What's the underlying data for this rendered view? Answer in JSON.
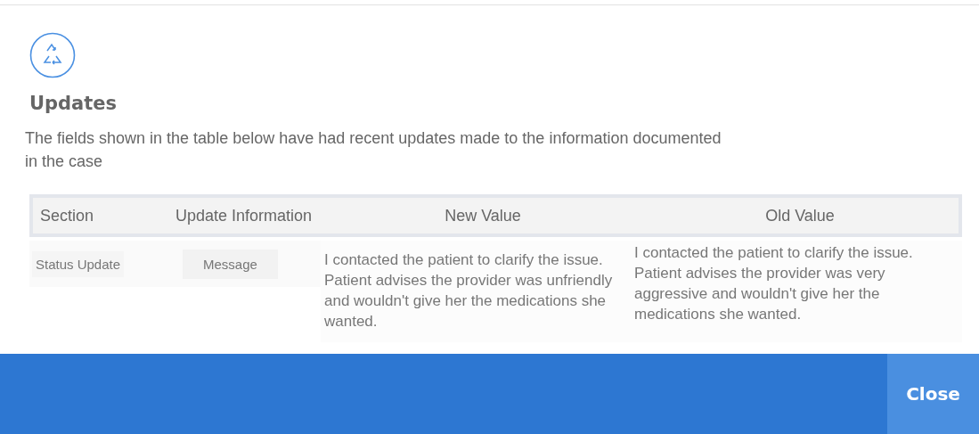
{
  "dialog": {
    "title": "Updates",
    "description": "The fields shown in the table below have had recent updates made to the information documented in the case"
  },
  "table": {
    "columns": [
      "Section",
      "Update Information",
      "New Value",
      "Old Value"
    ],
    "rows": [
      {
        "section": "Status Update",
        "update_information": "Message",
        "new_value": "I contacted the patient to clarify the issue. Patient advises the provider was unfriendly and wouldn't give her the medications she wanted.",
        "old_value": "I contacted the patient to clarify the issue. Patient advises the provider was very aggressive and wouldn't give her the medications she wanted."
      }
    ]
  },
  "footer": {
    "buttons": [
      "Close"
    ]
  }
}
